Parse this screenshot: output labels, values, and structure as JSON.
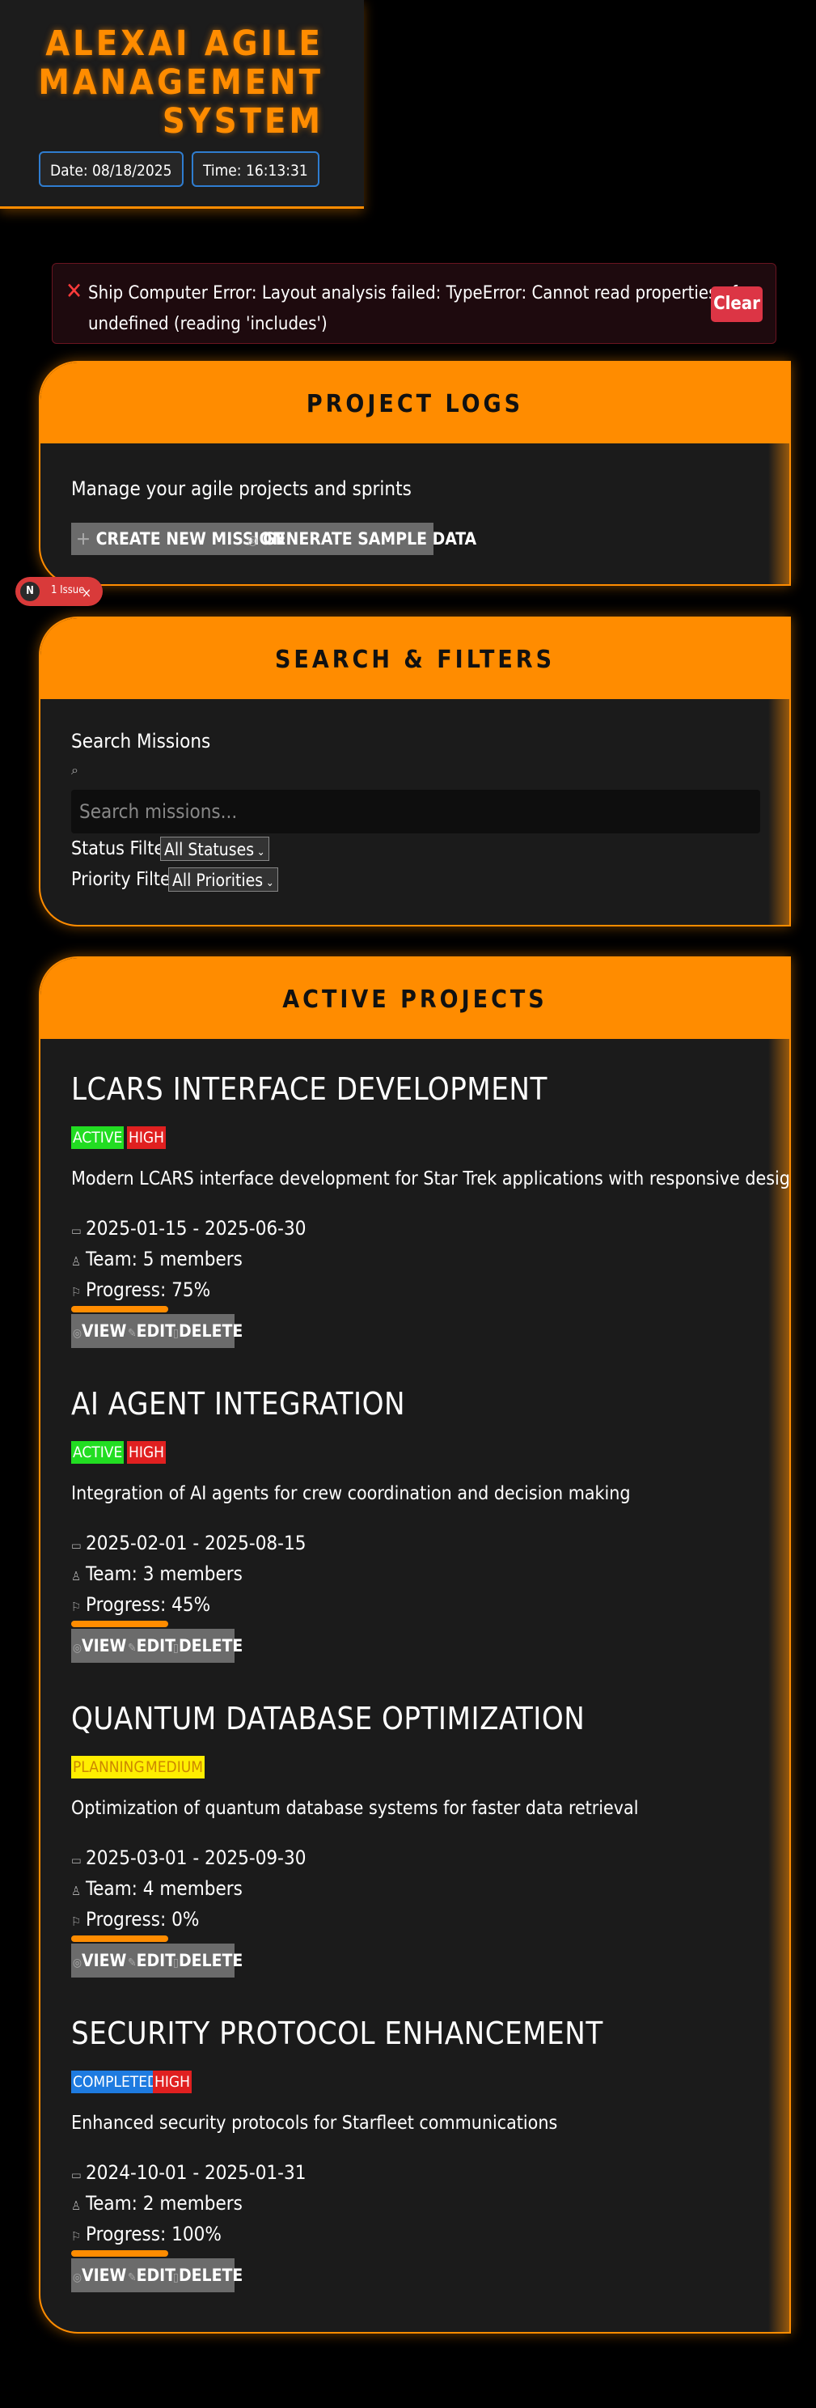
{
  "header": {
    "title_lines": [
      "ALEXAI AGILE",
      "MANAGEMENT",
      "SYSTEM"
    ],
    "date_label": "Date: 08/18/2025",
    "time_label": "Time: 16:13:31"
  },
  "error": {
    "message": "Ship Computer Error: Layout analysis failed: TypeError: Cannot read properties of undefined (reading 'includes')",
    "clear_label": "Clear"
  },
  "project_logs": {
    "title": "PROJECT LOGS",
    "subtitle": "Manage your agile projects and sprints",
    "create_label": "CREATE NEW MISSION",
    "sample_label": "GENERATE SAMPLE DATA"
  },
  "dev_badge": {
    "letter": "N",
    "label": "1 Issue",
    "close": "×"
  },
  "filters": {
    "title": "SEARCH & FILTERS",
    "search_label": "Search Missions",
    "search_placeholder": "Search missions...",
    "status_label": "Status Filter",
    "status_value": "All Statuses",
    "priority_label": "Priority Filter",
    "priority_value": "All Priorities"
  },
  "active_projects": {
    "title": "ACTIVE PROJECTS",
    "projects": [
      {
        "name": "LCARS INTERFACE DEVELOPMENT",
        "status": "ACTIVE",
        "priority": "HIGH",
        "status_color": "#22dd22",
        "priority_color": "#e02020",
        "description": "Modern LCARS interface development for Star Trek applications with responsive design",
        "dates": "2025-01-15 - 2025-06-30",
        "team": "Team: 5 members",
        "progress_label": "Progress: 75%",
        "progress": 75
      },
      {
        "name": "AI AGENT INTEGRATION",
        "status": "ACTIVE",
        "priority": "HIGH",
        "status_color": "#22dd22",
        "priority_color": "#e02020",
        "description": "Integration of AI agents for crew coordination and decision making",
        "dates": "2025-02-01 - 2025-08-15",
        "team": "Team: 3 members",
        "progress_label": "Progress: 45%",
        "progress": 45
      },
      {
        "name": "QUANTUM DATABASE OPTIMIZATION",
        "status": "PLANNING",
        "priority": "MEDIUM",
        "status_color": "#ffee00",
        "priority_color": "#ffee00",
        "description": "Optimization of quantum database systems for faster data retrieval",
        "dates": "2025-03-01 - 2025-09-30",
        "team": "Team: 4 members",
        "progress_label": "Progress: 0%",
        "progress": 0
      },
      {
        "name": "SECURITY PROTOCOL ENHANCEMENT",
        "status": "COMPLETED",
        "priority": "HIGH",
        "status_color": "#1e7be0",
        "priority_color": "#e02020",
        "description": "Enhanced security protocols for Starfleet communications",
        "dates": "2024-10-01 - 2025-01-31",
        "team": "Team: 2 members",
        "progress_label": "Progress: 100%",
        "progress": 100
      }
    ],
    "view_label": "VIEW",
    "edit_label": "EDIT",
    "delete_label": "DELETE"
  },
  "colors": {
    "accent": "#ff8c00",
    "panel": "#1b1b1b",
    "error": "#dc3545"
  }
}
